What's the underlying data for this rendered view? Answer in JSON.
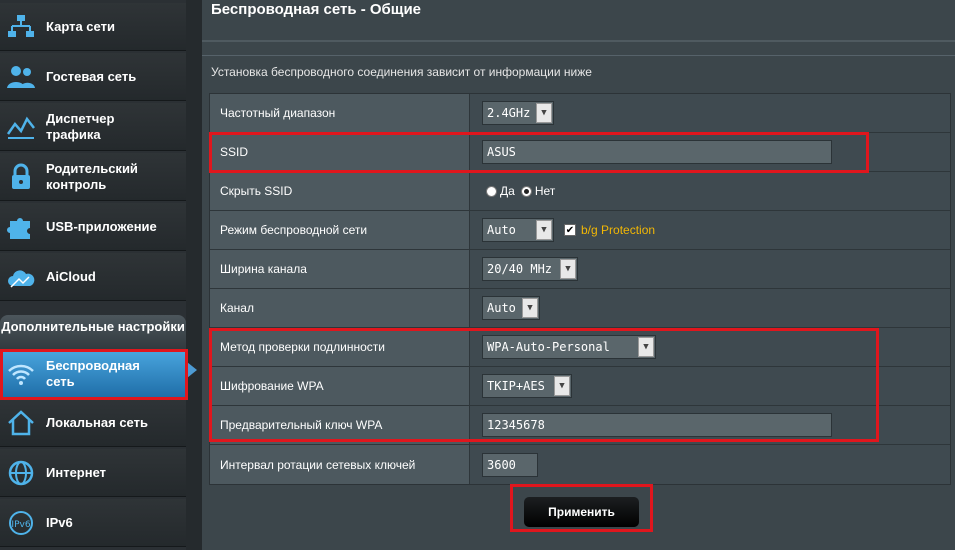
{
  "sidebar": {
    "items": [
      {
        "label": "Карта сети",
        "icon": "network-map-icon"
      },
      {
        "label": "Гостевая сеть",
        "icon": "guest-network-icon"
      },
      {
        "label": "Диспетчер\nтрафика",
        "icon": "traffic-manager-icon"
      },
      {
        "label": "Родительский\nконтроль",
        "icon": "lock-icon"
      },
      {
        "label": "USB-приложение",
        "icon": "puzzle-icon"
      },
      {
        "label": "AiCloud",
        "icon": "cloud-icon"
      }
    ],
    "advanced_header": "Дополнительные\nнастройки",
    "advanced_items": [
      {
        "label": "Беспроводная\nсеть",
        "icon": "wifi-icon",
        "active": true
      },
      {
        "label": "Локальная сеть",
        "icon": "home-icon"
      },
      {
        "label": "Интернет",
        "icon": "globe-icon"
      },
      {
        "label": "IPv6",
        "icon": "ipv6-icon"
      }
    ]
  },
  "page": {
    "title": "Беспроводная сеть - Общие",
    "description": "Установка беспроводного соединения зависит от информации ниже"
  },
  "form": {
    "band_label": "Частотный диапазон",
    "band_value": "2.4GHz",
    "ssid_label": "SSID",
    "ssid_value": "ASUS",
    "hide_ssid_label": "Скрыть SSID",
    "hide_yes": "Да",
    "hide_no": "Нет",
    "mode_label": "Режим беспроводной сети",
    "mode_value": "Auto",
    "bg_protection": "b/g Protection",
    "width_label": "Ширина канала",
    "width_value": "20/40 MHz",
    "channel_label": "Канал",
    "channel_value": "Auto",
    "auth_label": "Метод проверки подлинности",
    "auth_value": "WPA-Auto-Personal",
    "enc_label": "Шифрование WPA",
    "enc_value": "TKIP+AES",
    "psk_label": "Предварительный ключ WPA",
    "psk_value": "12345678",
    "rotation_label": "Интервал ротации сетевых ключей",
    "rotation_value": "3600"
  },
  "apply_label": "Применить",
  "colors": {
    "highlight": "#e0161d",
    "active_item": "#4aa6df",
    "protection_text": "#f2b705"
  }
}
